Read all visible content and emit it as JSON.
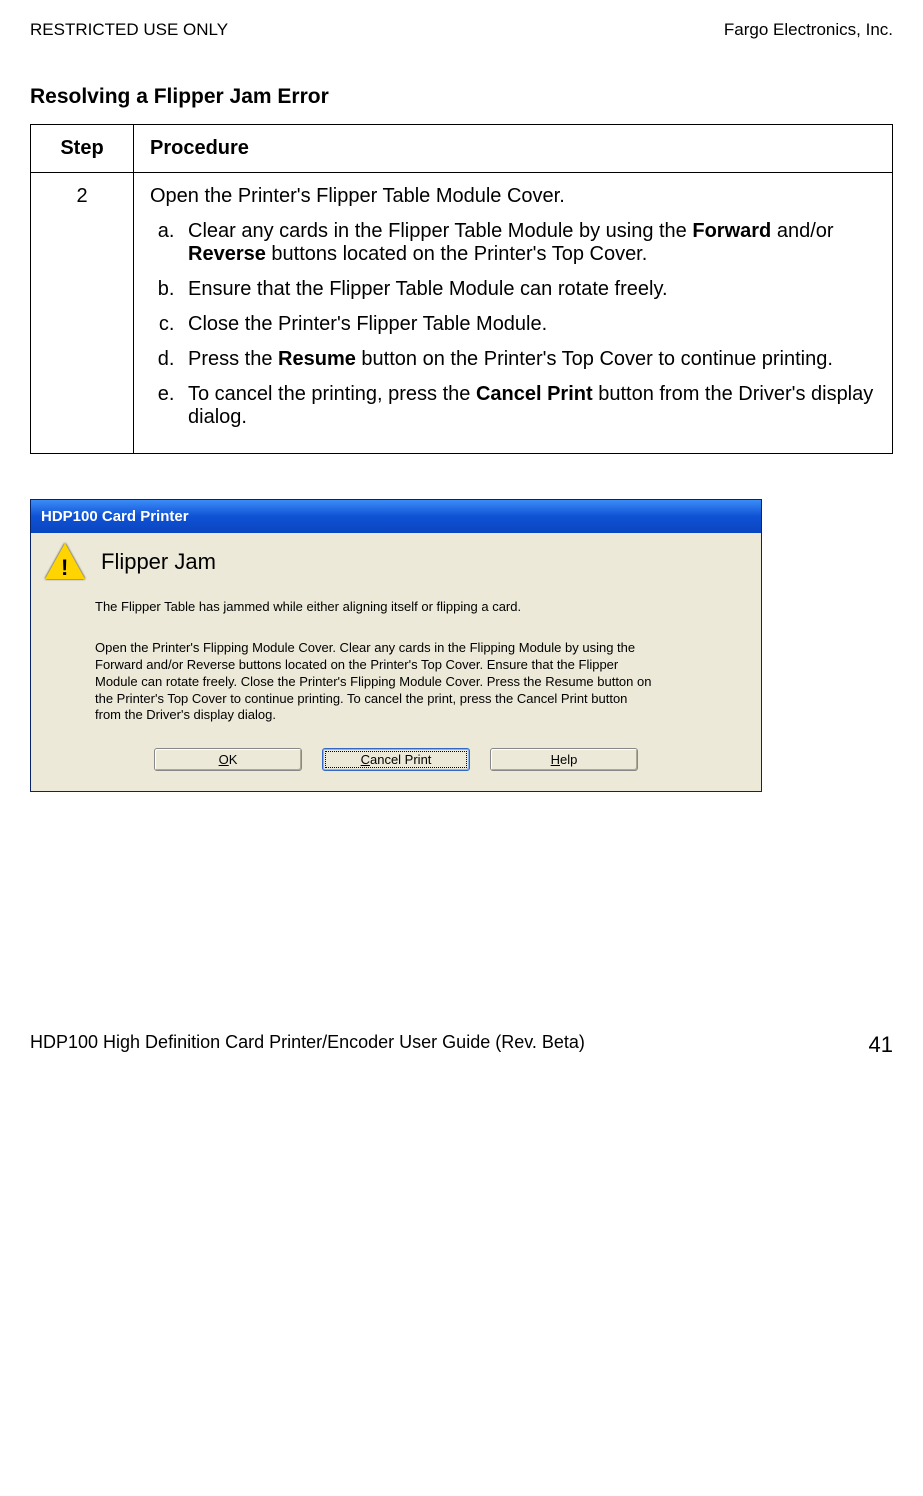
{
  "header": {
    "left": "RESTRICTED USE ONLY",
    "right": "Fargo Electronics, Inc."
  },
  "section_title": "Resolving a Flipper Jam Error",
  "table": {
    "headers": {
      "step": "Step",
      "procedure": "Procedure"
    },
    "row": {
      "step": "2",
      "intro": "Open the Printer's Flipper Table Module Cover.",
      "items": {
        "a_pre": "Clear any cards in the Flipper Table Module by using the ",
        "a_b1": "Forward",
        "a_mid": " and/or ",
        "a_b2": "Reverse",
        "a_post": " buttons located on the Printer's Top Cover.",
        "b": "Ensure that the Flipper Table Module can rotate freely.",
        "c": "Close the Printer's Flipper Table Module.",
        "d_pre": "Press the ",
        "d_b1": "Resume",
        "d_post": " button on the Printer's Top Cover to continue printing.",
        "e_pre": "To cancel the printing, press the ",
        "e_b1": "Cancel Print",
        "e_post": " button from the Driver's display dialog."
      }
    }
  },
  "dialog": {
    "title": "HDP100 Card Printer",
    "heading": "Flipper Jam",
    "para1": "The Flipper Table has jammed while either aligning itself or flipping a card.",
    "para2": "Open the Printer's Flipping Module Cover. Clear any cards in the Flipping Module by using the Forward and/or Reverse buttons located on the Printer's Top Cover. Ensure that the Flipper Module can rotate freely. Close the Printer's Flipping Module Cover. Press the Resume button on the Printer's Top Cover to continue printing. To cancel the print, press the Cancel Print button from the Driver's display dialog.",
    "buttons": {
      "ok_u": "O",
      "ok_rest": "K",
      "cancel_u": "C",
      "cancel_rest": "ancel Print",
      "help_u": "H",
      "help_rest": "elp"
    }
  },
  "footer": {
    "left": "HDP100 High Definition Card Printer/Encoder User Guide (Rev. Beta)",
    "page": "41"
  }
}
